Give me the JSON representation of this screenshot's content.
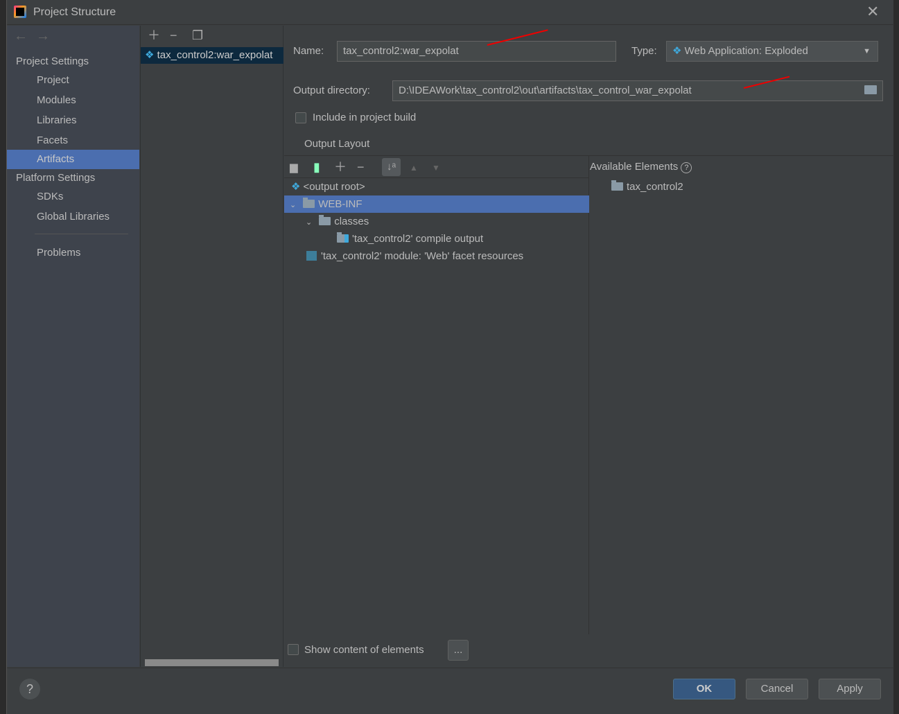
{
  "window": {
    "title": "Project Structure"
  },
  "sidebar": {
    "project_settings": "Project Settings",
    "items": [
      {
        "label": "Project"
      },
      {
        "label": "Modules"
      },
      {
        "label": "Libraries"
      },
      {
        "label": "Facets"
      },
      {
        "label": "Artifacts",
        "selected": true
      }
    ],
    "platform_settings": "Platform Settings",
    "platform_items": [
      {
        "label": "SDKs"
      },
      {
        "label": "Global Libraries"
      }
    ],
    "problems": "Problems"
  },
  "artifacts_list": {
    "items": [
      {
        "label": "tax_control2:war_expolat"
      }
    ]
  },
  "form": {
    "name_label": "Name:",
    "name_value": "tax_control2:war_expolat",
    "type_label": "Type:",
    "type_value": "Web Application: Exploded",
    "output_dir_label": "Output directory:",
    "output_dir_value": "D:\\IDEAWork\\tax_control2\\out\\artifacts\\tax_control_war_expolat",
    "include_build_label": "Include in project build",
    "include_build_checked": false
  },
  "output_layout": {
    "tab": "Output Layout",
    "tree": [
      {
        "label": "<output root>",
        "icon": "artifact-icon"
      },
      {
        "label": "WEB-INF",
        "icon": "folder-icon",
        "selected": true,
        "expanded": true
      },
      {
        "label": "classes",
        "icon": "folder-icon",
        "expanded": true
      },
      {
        "label": "'tax_control2' compile output",
        "icon": "module-output-icon"
      },
      {
        "label": "'tax_control2' module: 'Web' facet resources",
        "icon": "web-facet-icon"
      }
    ],
    "available_elements_label": "Available Elements",
    "available": [
      {
        "label": "tax_control2"
      }
    ],
    "show_content_label": "Show content of elements",
    "show_content_checked": false,
    "more_button": "..."
  },
  "footer": {
    "help": "?",
    "ok": "OK",
    "cancel": "Cancel",
    "apply": "Apply"
  },
  "colors": {
    "selection": "#4b6eaf",
    "accent_ok": "#365880",
    "annotation_arrow": "#ee0000"
  }
}
